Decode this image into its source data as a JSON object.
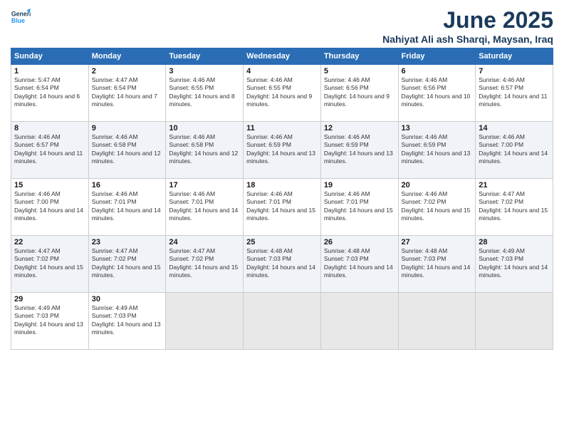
{
  "header": {
    "logo_line1": "General",
    "logo_line2": "Blue",
    "month": "June 2025",
    "location": "Nahiyat Ali ash Sharqi, Maysan, Iraq"
  },
  "weekdays": [
    "Sunday",
    "Monday",
    "Tuesday",
    "Wednesday",
    "Thursday",
    "Friday",
    "Saturday"
  ],
  "weeks": [
    [
      {
        "day": "1",
        "sunrise": "5:47 AM",
        "sunset": "6:54 PM",
        "daylight": "14 hours and 6 minutes."
      },
      {
        "day": "2",
        "sunrise": "4:47 AM",
        "sunset": "6:54 PM",
        "daylight": "14 hours and 7 minutes."
      },
      {
        "day": "3",
        "sunrise": "4:46 AM",
        "sunset": "6:55 PM",
        "daylight": "14 hours and 8 minutes."
      },
      {
        "day": "4",
        "sunrise": "4:46 AM",
        "sunset": "6:55 PM",
        "daylight": "14 hours and 9 minutes."
      },
      {
        "day": "5",
        "sunrise": "4:46 AM",
        "sunset": "6:56 PM",
        "daylight": "14 hours and 9 minutes."
      },
      {
        "day": "6",
        "sunrise": "4:46 AM",
        "sunset": "6:56 PM",
        "daylight": "14 hours and 10 minutes."
      },
      {
        "day": "7",
        "sunrise": "4:46 AM",
        "sunset": "6:57 PM",
        "daylight": "14 hours and 11 minutes."
      }
    ],
    [
      {
        "day": "8",
        "sunrise": "4:46 AM",
        "sunset": "6:57 PM",
        "daylight": "14 hours and 11 minutes."
      },
      {
        "day": "9",
        "sunrise": "4:46 AM",
        "sunset": "6:58 PM",
        "daylight": "14 hours and 12 minutes."
      },
      {
        "day": "10",
        "sunrise": "4:46 AM",
        "sunset": "6:58 PM",
        "daylight": "14 hours and 12 minutes."
      },
      {
        "day": "11",
        "sunrise": "4:46 AM",
        "sunset": "6:59 PM",
        "daylight": "14 hours and 13 minutes."
      },
      {
        "day": "12",
        "sunrise": "4:46 AM",
        "sunset": "6:59 PM",
        "daylight": "14 hours and 13 minutes."
      },
      {
        "day": "13",
        "sunrise": "4:46 AM",
        "sunset": "6:59 PM",
        "daylight": "14 hours and 13 minutes."
      },
      {
        "day": "14",
        "sunrise": "4:46 AM",
        "sunset": "7:00 PM",
        "daylight": "14 hours and 14 minutes."
      }
    ],
    [
      {
        "day": "15",
        "sunrise": "4:46 AM",
        "sunset": "7:00 PM",
        "daylight": "14 hours and 14 minutes."
      },
      {
        "day": "16",
        "sunrise": "4:46 AM",
        "sunset": "7:01 PM",
        "daylight": "14 hours and 14 minutes."
      },
      {
        "day": "17",
        "sunrise": "4:46 AM",
        "sunset": "7:01 PM",
        "daylight": "14 hours and 14 minutes."
      },
      {
        "day": "18",
        "sunrise": "4:46 AM",
        "sunset": "7:01 PM",
        "daylight": "14 hours and 15 minutes."
      },
      {
        "day": "19",
        "sunrise": "4:46 AM",
        "sunset": "7:01 PM",
        "daylight": "14 hours and 15 minutes."
      },
      {
        "day": "20",
        "sunrise": "4:46 AM",
        "sunset": "7:02 PM",
        "daylight": "14 hours and 15 minutes."
      },
      {
        "day": "21",
        "sunrise": "4:47 AM",
        "sunset": "7:02 PM",
        "daylight": "14 hours and 15 minutes."
      }
    ],
    [
      {
        "day": "22",
        "sunrise": "4:47 AM",
        "sunset": "7:02 PM",
        "daylight": "14 hours and 15 minutes."
      },
      {
        "day": "23",
        "sunrise": "4:47 AM",
        "sunset": "7:02 PM",
        "daylight": "14 hours and 15 minutes."
      },
      {
        "day": "24",
        "sunrise": "4:47 AM",
        "sunset": "7:02 PM",
        "daylight": "14 hours and 15 minutes."
      },
      {
        "day": "25",
        "sunrise": "4:48 AM",
        "sunset": "7:03 PM",
        "daylight": "14 hours and 14 minutes."
      },
      {
        "day": "26",
        "sunrise": "4:48 AM",
        "sunset": "7:03 PM",
        "daylight": "14 hours and 14 minutes."
      },
      {
        "day": "27",
        "sunrise": "4:48 AM",
        "sunset": "7:03 PM",
        "daylight": "14 hours and 14 minutes."
      },
      {
        "day": "28",
        "sunrise": "4:49 AM",
        "sunset": "7:03 PM",
        "daylight": "14 hours and 14 minutes."
      }
    ],
    [
      {
        "day": "29",
        "sunrise": "4:49 AM",
        "sunset": "7:03 PM",
        "daylight": "14 hours and 13 minutes."
      },
      {
        "day": "30",
        "sunrise": "4:49 AM",
        "sunset": "7:03 PM",
        "daylight": "14 hours and 13 minutes."
      },
      null,
      null,
      null,
      null,
      null
    ]
  ],
  "labels": {
    "sunrise": "Sunrise:",
    "sunset": "Sunset:",
    "daylight": "Daylight:"
  }
}
